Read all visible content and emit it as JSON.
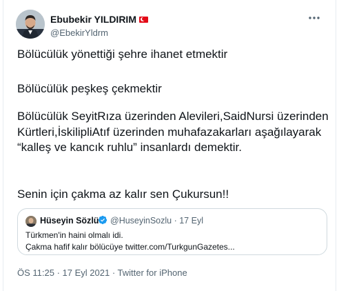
{
  "author": {
    "name": "Ebubekir YILDIRIM",
    "handle": "@EbekirYldrm",
    "flag_icon": "turkey-flag-icon"
  },
  "tweet": {
    "paragraphs": [
      "Bölücülük yönettiği şehre ihanet etmektir",
      "Bölücülük peşkeş çekmektir",
      "Bölücülük SeyitRıza üzerinden Alevileri,SaidNursi üzerinden Kürtleri,İskilipliAtıf üzerinden muhafazakarları aşağılayarak “kalleş ve kancık ruhlu” insanlardı demektir.",
      "Senin için çakma az kalır sen Çukursun!!"
    ]
  },
  "quote": {
    "name": "Hüseyin Sözlü",
    "handle_date": "@HuseyinSozlu · 17 Eyl",
    "line1": "Türkmen'in haini olmalı idi.",
    "line2": "Çakma hafif kalır bölücüye twitter.com/TurkgunGazetes..."
  },
  "meta": {
    "time": "ÖS 11:25",
    "sep1": " · ",
    "date": "17 Eyl 2021",
    "sep2": " · ",
    "source": "Twitter for iPhone"
  },
  "colors": {
    "text": "#0f1419",
    "secondary": "#536471",
    "border": "#cfd9de",
    "verified": "#1d9bf0"
  }
}
